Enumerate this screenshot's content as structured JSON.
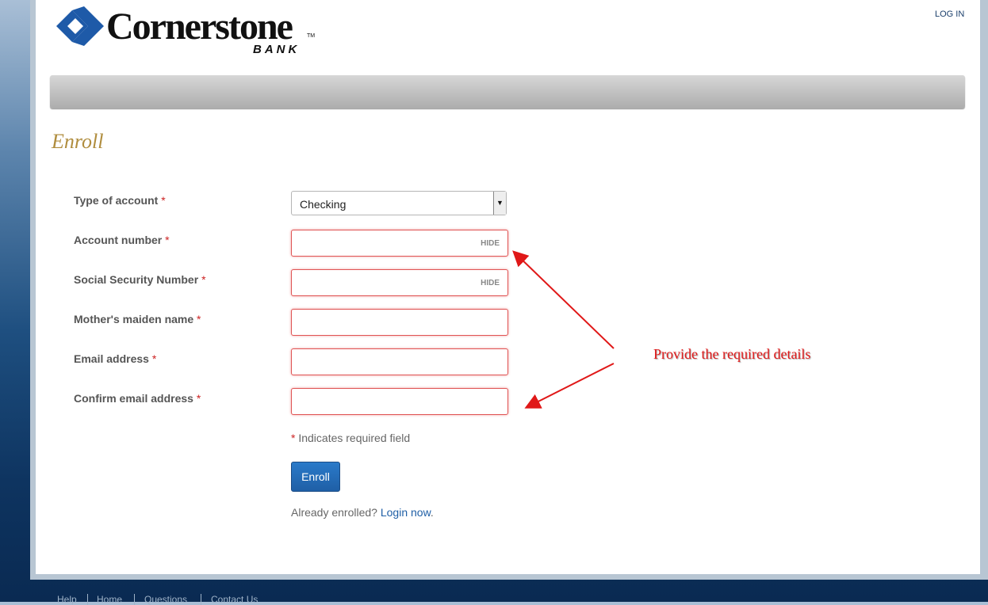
{
  "header": {
    "logo_word": "Cornerstone",
    "logo_sub": "BANK",
    "logo_tm": "TM",
    "login_label": "LOG IN"
  },
  "page_title": "Enroll",
  "form": {
    "fields": [
      {
        "label": "Type of account",
        "type": "select",
        "value": "Checking"
      },
      {
        "label": "Account number",
        "type": "text",
        "value": "",
        "toggle": "HIDE"
      },
      {
        "label": "Social Security Number",
        "type": "text",
        "value": "",
        "toggle": "HIDE"
      },
      {
        "label": "Mother's maiden name",
        "type": "text",
        "value": ""
      },
      {
        "label": "Email address",
        "type": "text",
        "value": ""
      },
      {
        "label": "Confirm email address",
        "type": "text",
        "value": ""
      }
    ],
    "required_marker": "*",
    "required_note": "Indicates required field",
    "submit_label": "Enroll",
    "already_text": "Already enrolled?",
    "login_now": "Login now",
    "period": "."
  },
  "annotation": {
    "text": "Provide the required details",
    "color": "#e01818"
  },
  "footer": {
    "links": [
      "Help",
      "Home",
      "Questions",
      "Contact Us"
    ]
  },
  "colors": {
    "title": "#b08d3e",
    "error_border": "#e05555",
    "button": "#1f5fa6"
  }
}
